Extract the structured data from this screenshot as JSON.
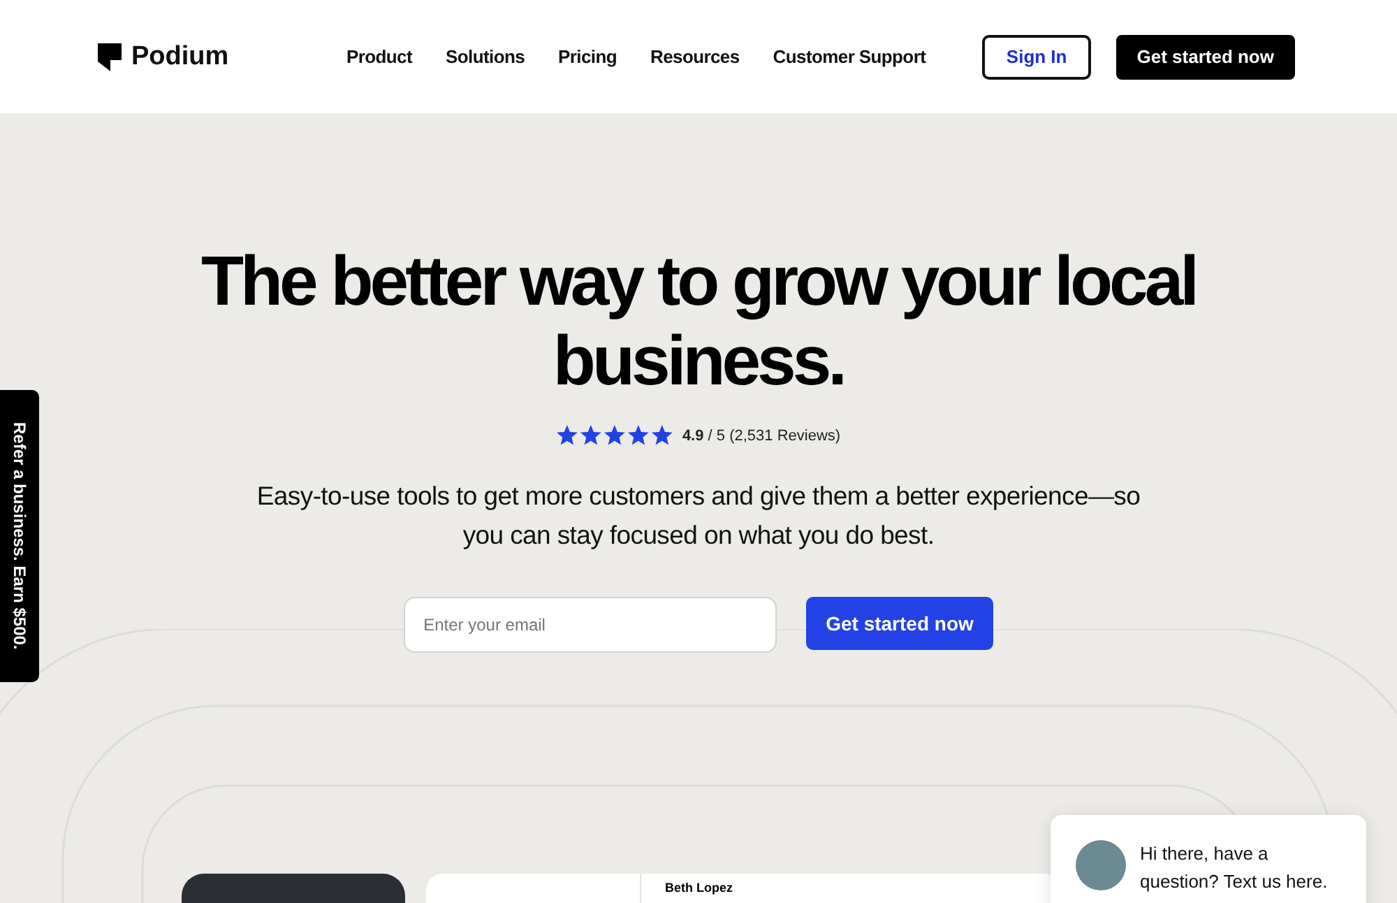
{
  "brand": {
    "name": "Podium"
  },
  "nav": [
    "Product",
    "Solutions",
    "Pricing",
    "Resources",
    "Customer Support"
  ],
  "header_buttons": {
    "sign_in": "Sign In",
    "get_started": "Get started now"
  },
  "hero": {
    "title": "The better way to grow your local business.",
    "rating": {
      "stars": 5,
      "score": "4.9",
      "rest": "/ 5 (2,531 Reviews)"
    },
    "subtitle": "Easy-to-use tools to get more customers and give them a better experience—so you can stay focused on what you do best.",
    "email": {
      "placeholder": "Enter your email"
    },
    "cta": "Get started now"
  },
  "side_tab": "Refer a business. Earn $500.",
  "preview": {
    "contact_name": "Beth Lopez"
  },
  "chat": {
    "message": "Hi there, have a question? Text us here."
  }
}
